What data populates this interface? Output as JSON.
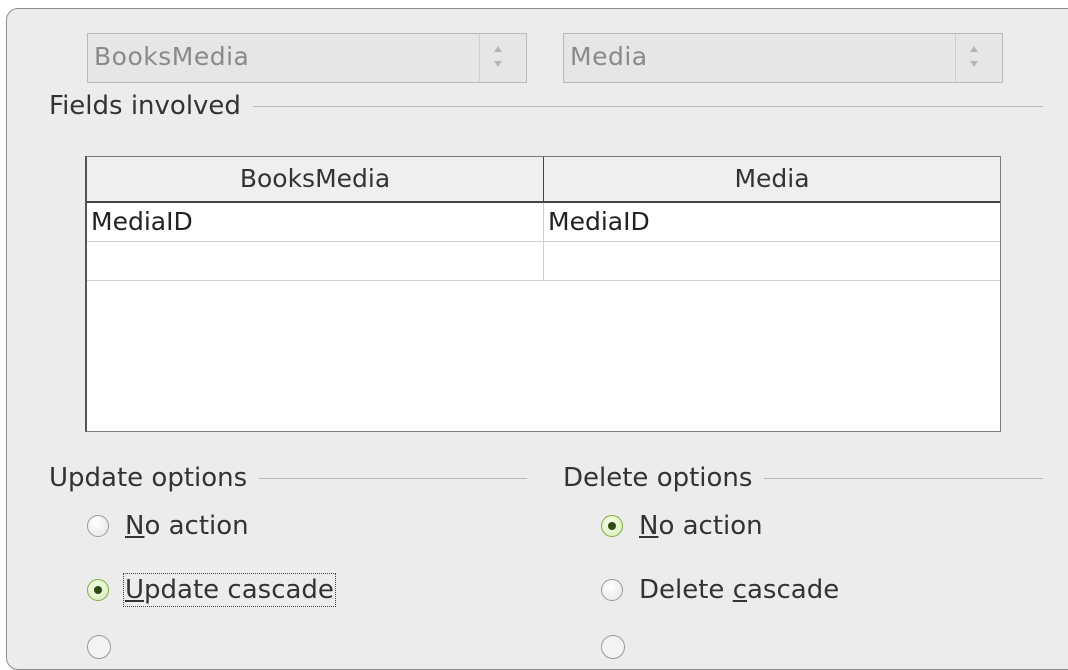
{
  "tables": {
    "left": "BooksMedia",
    "right": "Media"
  },
  "fields_involved": {
    "heading": "Fields involved",
    "columns": [
      "BooksMedia",
      "Media"
    ],
    "rows": [
      [
        "MediaID",
        "MediaID"
      ],
      [
        "",
        ""
      ]
    ]
  },
  "update_options": {
    "heading": "Update options",
    "options": [
      {
        "mnemonic": "N",
        "rest": "o action",
        "selected": false
      },
      {
        "mnemonic": "U",
        "rest": "pdate cascade",
        "selected": true
      }
    ]
  },
  "delete_options": {
    "heading": "Delete options",
    "options": [
      {
        "pre": "",
        "mnemonic": "N",
        "rest": "o action",
        "selected": true
      },
      {
        "pre": "Delete ",
        "mnemonic": "c",
        "rest": "ascade",
        "selected": false
      }
    ]
  },
  "colors": {
    "dialog_bg": "#ececec",
    "selected_radio": "#7fae3f"
  }
}
